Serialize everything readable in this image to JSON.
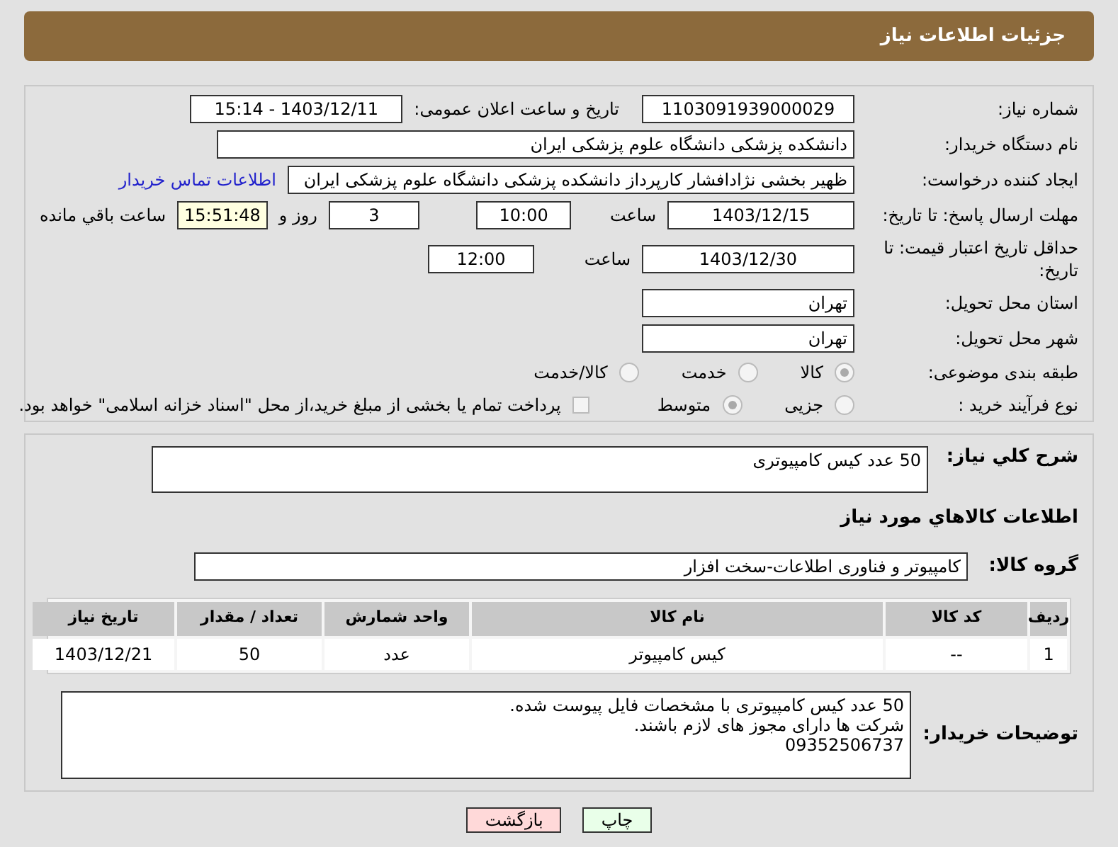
{
  "header": {
    "title": "جزئیات اطلاعات نیاز"
  },
  "details": {
    "need_number": {
      "label": "شماره نیاز:",
      "value": "1103091939000029"
    },
    "announce": {
      "label": "تاریخ و ساعت اعلان عمومی:",
      "value": "1403/12/11 - 15:14"
    },
    "buyer_org": {
      "label": "نام دستگاه خریدار:",
      "value": "دانشکده پزشکی دانشگاه علوم پزشکی ایران"
    },
    "creator": {
      "label": "ایجاد کننده درخواست:",
      "value": "ظهیر بخشی نژادافشار کارپرداز دانشکده پزشکی دانشگاه علوم پزشکی ایران",
      "link": "اطلاعات تماس خریدار"
    },
    "deadline": {
      "label": "مهلت ارسال پاسخ: تا تاریخ:",
      "date": "1403/12/15",
      "time_label": "ساعت",
      "time": "10:00",
      "days": "3",
      "days_label": "روز و",
      "remaining": "15:51:48",
      "remaining_label": "ساعت باقي مانده"
    },
    "validity": {
      "label": "حداقل تاریخ اعتبار قیمت: تا تاریخ:",
      "date": "1403/12/30",
      "time_label": "ساعت",
      "time": "12:00"
    },
    "province": {
      "label": "استان محل تحویل:",
      "value": "تهران"
    },
    "city": {
      "label": "شهر محل تحویل:",
      "value": "تهران"
    },
    "category": {
      "label": "طبقه بندی موضوعی:",
      "options": [
        {
          "label": "کالا",
          "selected": true
        },
        {
          "label": "خدمت",
          "selected": false
        },
        {
          "label": "کالا/خدمت",
          "selected": false
        }
      ]
    },
    "process": {
      "label": "نوع فرآیند خرید :",
      "options": [
        {
          "label": "جزیی",
          "selected": false
        },
        {
          "label": "متوسط",
          "selected": true
        }
      ],
      "treasury": {
        "label": "پرداخت تمام یا بخشی از مبلغ خرید،از محل \"اسناد خزانه اسلامی\" خواهد بود.",
        "checked": false
      }
    }
  },
  "goods": {
    "summary": {
      "label": "شرح كلي نياز:",
      "value": "50 عدد کیس کامپیوتری"
    },
    "heading": "اطلاعات كالاهاي مورد نياز",
    "group": {
      "label": "گروه کالا:",
      "value": "کامپیوتر و فناوری اطلاعات-سخت افزار"
    },
    "table": {
      "columns": [
        "ردیف",
        "کد کالا",
        "نام کالا",
        "واحد شمارش",
        "تعداد / مقدار",
        "تاریخ نیاز"
      ],
      "rows": [
        [
          "1",
          "--",
          "کیس کامپیوتر",
          "عدد",
          "50",
          "1403/12/21"
        ]
      ]
    },
    "notes": {
      "label": "توضیحات خریدار:",
      "lines": [
        "50 عدد کیس کامپیوتری با مشخصات فایل پیوست شده.",
        "شرکت ها دارای مجوز های لازم باشند.",
        "09352506737"
      ]
    }
  },
  "buttons": [
    {
      "label": "چاپ",
      "kind": "print"
    },
    {
      "label": "بازگشت",
      "kind": "back"
    }
  ]
}
